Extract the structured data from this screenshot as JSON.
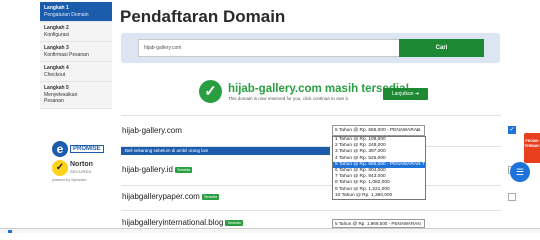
{
  "page_title": "Pendaftaran Domain",
  "sidebar": {
    "steps": [
      {
        "title": "Langkah 1",
        "subtitle": "Pengaturan Domain",
        "active": true
      },
      {
        "title": "Langkah 2",
        "subtitle": "Konfigurasi",
        "active": false
      },
      {
        "title": "Langkah 3",
        "subtitle": "Konfirmasi Pesanan",
        "active": false
      },
      {
        "title": "Langkah 4",
        "subtitle": "Checkout",
        "active": false
      },
      {
        "title": "Langkah 5",
        "subtitle": "Menyelesaikan",
        "subtitle2": "Pesanan",
        "active": false
      }
    ]
  },
  "badges": {
    "promise_label": "PROMISE",
    "promise_letter": "e",
    "norton_label": "Norton",
    "norton_sub": "SECURED",
    "norton_powered": "powered by Symantec"
  },
  "search": {
    "value": "hijab-gallery.com",
    "button_label": "Cari"
  },
  "availability": {
    "headline": "hijab-gallery.com masih tersedia!",
    "subtext": "This domain is now reserved for you, click continue to own it.",
    "continue_label": "Lanjutkan"
  },
  "results": {
    "promo_bar": "Beli sekarang sebelum di ambil orang lain",
    "rows": [
      {
        "domain": "hijab-gallery.com",
        "tag": ""
      },
      {
        "domain": "hijab-gallery.id",
        "tag": "Tersedia"
      },
      {
        "domain": "hijabgallerypaper.com",
        "tag": "Tersedia"
      },
      {
        "domain": "hijabgalleryinternational.blog",
        "tag": "Tersedia"
      }
    ],
    "selected_price": "5 Tahun @ Rp. 665,000 - PENAWARAN TE",
    "options": [
      "1 Tahun @ Rp. 109,000",
      "2 Tahun @ Rp. 248,000",
      "3 Tahun @ Rp. 387,000",
      "4 Tahun @ Rp. 526,000",
      "5 Tahun @ Rp. 665,000 - PENAWARAN TERBAIK",
      "6 Tahun @ Rp. 804,000",
      "7 Tahun @ Rp. 943,000",
      "8 Tahun @ Rp. 1,082,000",
      "9 Tahun @ Rp. 1,221,000",
      "10 Tahun @ Rp. 1,360,000"
    ],
    "highlighted_option_index": 4,
    "last_row_price": "5 Tahun @ Rp. 1,969,500 - PENAWARAN"
  },
  "widgets": {
    "promo_label": "PROMO TERBAIK"
  }
}
